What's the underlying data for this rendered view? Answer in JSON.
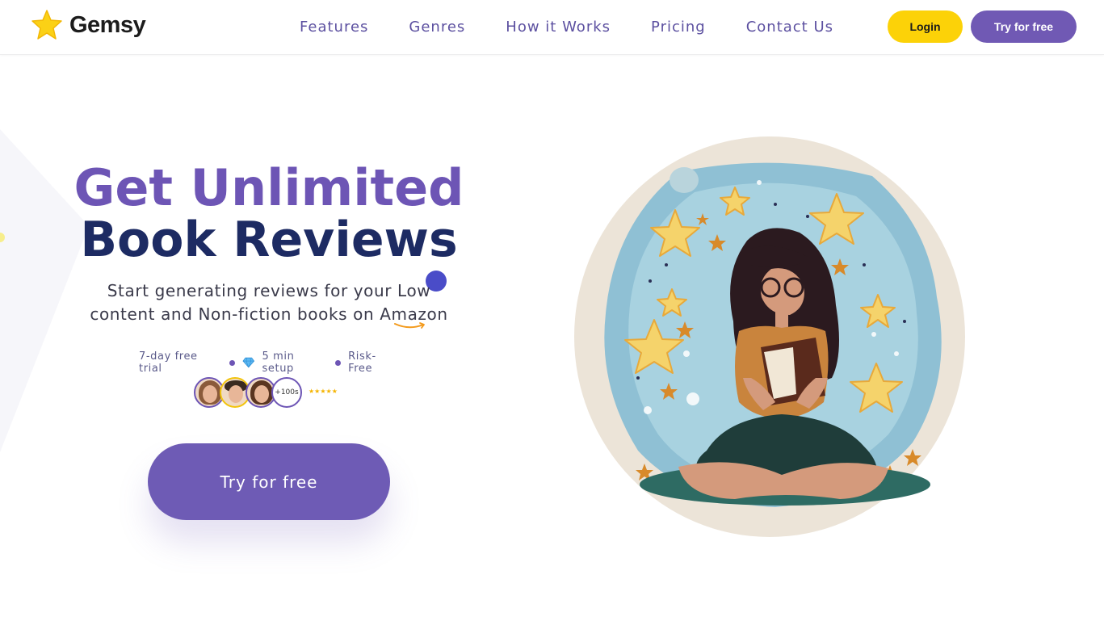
{
  "header": {
    "brand": "Gemsy",
    "nav": [
      "Features",
      "Genres",
      "How it Works",
      "Pricing",
      "Contact Us"
    ],
    "login_label": "Login",
    "try_label": "Try for free"
  },
  "hero": {
    "title_line1": "Get Unlimited",
    "title_line2": "Book Reviews",
    "subtitle_line1": "Start generating reviews for your Low",
    "subtitle_line2": "content and Non-fiction books on Amazon",
    "badges": [
      "7-day free trial",
      "5 min setup",
      "Risk-Free"
    ],
    "social_proof_count": "+100s",
    "rating_stars": "★★★★★",
    "cta_label": "Try for free"
  },
  "colors": {
    "primary": "#6d55b5",
    "navy": "#1d2b63",
    "yellow": "#fcd208"
  },
  "icons": {
    "logo": "star-icon",
    "badge_2": "diamond-icon"
  }
}
